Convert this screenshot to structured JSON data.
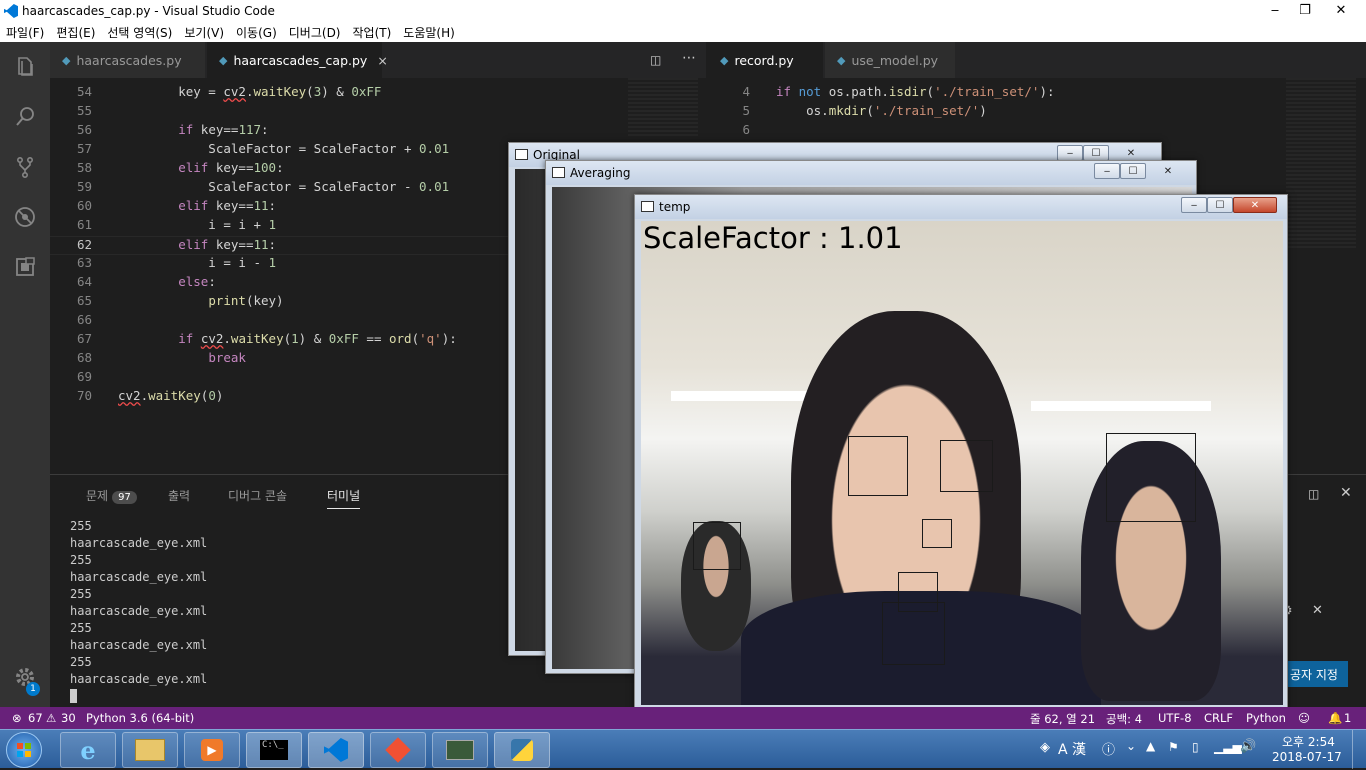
{
  "window": {
    "title": "haarcascades_cap.py - Visual Studio Code"
  },
  "menu": [
    "파일(F)",
    "편집(E)",
    "선택 영역(S)",
    "보기(V)",
    "이동(G)",
    "디버그(D)",
    "작업(T)",
    "도움말(H)"
  ],
  "tabs_left": [
    {
      "label": "haarcascades.py"
    },
    {
      "label": "haarcascades_cap.py",
      "close": "×"
    }
  ],
  "tabs_right": [
    {
      "label": "record.py"
    },
    {
      "label": "use_model.py"
    }
  ],
  "editor_left": {
    "lines": [
      {
        "n": "54",
        "text": "        key = cv2.waitKey(3) & 0xFF"
      },
      {
        "n": "55",
        "text": ""
      },
      {
        "n": "56",
        "text": "        if key==117:"
      },
      {
        "n": "57",
        "text": "            ScaleFactor = ScaleFactor + 0.01"
      },
      {
        "n": "58",
        "text": "        elif key==100:"
      },
      {
        "n": "59",
        "text": "            ScaleFactor = ScaleFactor - 0.01"
      },
      {
        "n": "60",
        "text": "        elif key==11:"
      },
      {
        "n": "61",
        "text": "            i = i + 1"
      },
      {
        "n": "62",
        "text": "        elif key==11:"
      },
      {
        "n": "63",
        "text": "            i = i - 1"
      },
      {
        "n": "64",
        "text": "        else:"
      },
      {
        "n": "65",
        "text": "            print(key)"
      },
      {
        "n": "66",
        "text": ""
      },
      {
        "n": "67",
        "text": "        if cv2.waitKey(1) & 0xFF == ord('q'):"
      },
      {
        "n": "68",
        "text": "            break"
      },
      {
        "n": "69",
        "text": ""
      },
      {
        "n": "70",
        "text": "cv2.waitKey(0)"
      }
    ]
  },
  "editor_right": {
    "lines": [
      {
        "n": "4",
        "text": "if not os.path.isdir('./train_set/'):"
      },
      {
        "n": "5",
        "text": "    os.mkdir('./train_set/')"
      },
      {
        "n": "6",
        "text": ""
      }
    ]
  },
  "panel": {
    "tabs": [
      "문제",
      "출력",
      "디버그 콘솔",
      "터미널"
    ],
    "problems_count": "97",
    "terminal_lines": [
      "255",
      "haarcascade_eye.xml",
      "255",
      "haarcascade_eye.xml",
      "255",
      "haarcascade_eye.xml",
      "255",
      "haarcascade_eye.xml",
      "255",
      "haarcascade_eye.xml"
    ],
    "settings_badge": "1",
    "notification_text": "공자 지정"
  },
  "cv_windows": [
    {
      "title": "Original"
    },
    {
      "title": "Averaging"
    },
    {
      "title": "temp",
      "overlay_text": "ScaleFactor : 1.01"
    }
  ],
  "status": {
    "errors": "67",
    "warnings": "30",
    "interpreter": "Python 3.6 (64-bit)",
    "position": "줄 62, 열 21",
    "spaces": "공백: 4",
    "encoding": "UTF-8",
    "eol": "CRLF",
    "language": "Python",
    "notifications": "1"
  },
  "tray": {
    "ime": "A 漢",
    "time": "오후 2:54",
    "date": "2018-07-17"
  },
  "colors": {
    "statusbar": "#68217a",
    "editor_bg": "#1e1e1e",
    "activity_bg": "#333333",
    "accent": "#0078d7"
  }
}
